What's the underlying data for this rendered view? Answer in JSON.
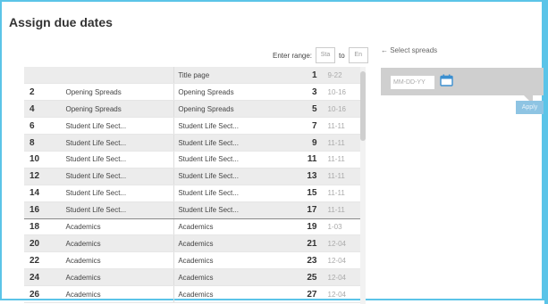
{
  "header": {
    "title": "Assign due dates"
  },
  "range": {
    "label": "Enter range:",
    "start_placeholder": "Sta",
    "to_label": "to",
    "end_placeholder": "En"
  },
  "select_spreads": {
    "label": "← Select spreads"
  },
  "date_panel": {
    "date_placeholder": "MM-DD-YY",
    "apply_label": "Apply",
    "accent_color": "#5bc4e8"
  },
  "rows": [
    {
      "num": "",
      "section1": "",
      "section2": "Title page",
      "page": "1",
      "date": "9-22",
      "shaded": true
    },
    {
      "num": "2",
      "section1": "Opening Spreads",
      "section2": "Opening Spreads",
      "page": "3",
      "date": "10-16",
      "shaded": false
    },
    {
      "num": "4",
      "section1": "Opening Spreads",
      "section2": "Opening Spreads",
      "page": "5",
      "date": "10-16",
      "shaded": true
    },
    {
      "num": "6",
      "section1": "Student Life Sect...",
      "section2": "Student Life Sect...",
      "page": "7",
      "date": "11-11",
      "shaded": false
    },
    {
      "num": "8",
      "section1": "Student Life Sect...",
      "section2": "Student Life Sect...",
      "page": "9",
      "date": "11-11",
      "shaded": true
    },
    {
      "num": "10",
      "section1": "Student Life Sect...",
      "section2": "Student Life Sect...",
      "page": "11",
      "date": "11-11",
      "shaded": false
    },
    {
      "num": "12",
      "section1": "Student Life Sect...",
      "section2": "Student Life Sect...",
      "page": "13",
      "date": "11-11",
      "shaded": true
    },
    {
      "num": "14",
      "section1": "Student Life Sect...",
      "section2": "Student Life Sect...",
      "page": "15",
      "date": "11-11",
      "shaded": false
    },
    {
      "num": "16",
      "section1": "Student Life Sect...",
      "section2": "Student Life Sect...",
      "page": "17",
      "date": "11-11",
      "shaded": true
    },
    {
      "num": "18",
      "section1": "Academics",
      "section2": "Academics",
      "page": "19",
      "date": "1-03",
      "shaded": false
    },
    {
      "num": "20",
      "section1": "Academics",
      "section2": "Academics",
      "page": "21",
      "date": "12-04",
      "shaded": true
    },
    {
      "num": "22",
      "section1": "Academics",
      "section2": "Academics",
      "page": "23",
      "date": "12-04",
      "shaded": false
    },
    {
      "num": "24",
      "section1": "Academics",
      "section2": "Academics",
      "page": "25",
      "date": "12-04",
      "shaded": true
    },
    {
      "num": "26",
      "section1": "Academics",
      "section2": "Academics",
      "page": "27",
      "date": "12-04",
      "shaded": false
    }
  ]
}
